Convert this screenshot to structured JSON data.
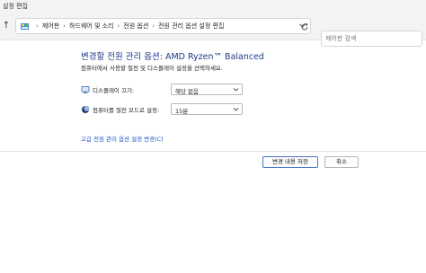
{
  "window": {
    "title": "설정 편집"
  },
  "nav": {
    "breadcrumbs": [
      "제어판",
      "하드웨어 및 소리",
      "전원 옵션",
      "전원 관리 옵션 설정 편집"
    ],
    "search_placeholder": "제어판 검색"
  },
  "page": {
    "title": "변경할 전원 관리 옵션: AMD Ryzen™ Balanced",
    "subtitle": "컴퓨터에서 사용할 절전 및 디스플레이 설정을 선택하세요."
  },
  "settings": [
    {
      "label": "디스플레이 끄기:",
      "value": "해당 없음",
      "icon": "monitor-icon"
    },
    {
      "label": "컴퓨터를 절전 모드로 설정:",
      "value": "15분",
      "icon": "moon-icon"
    }
  ],
  "advanced_link": "고급 전원 관리 옵션 설정 변경(C)",
  "buttons": {
    "save": "변경 내용 저장",
    "cancel": "취소"
  },
  "colors": {
    "title": "#1e3a8a",
    "link": "#1e56c8",
    "chrome": "#f3f3f3"
  }
}
